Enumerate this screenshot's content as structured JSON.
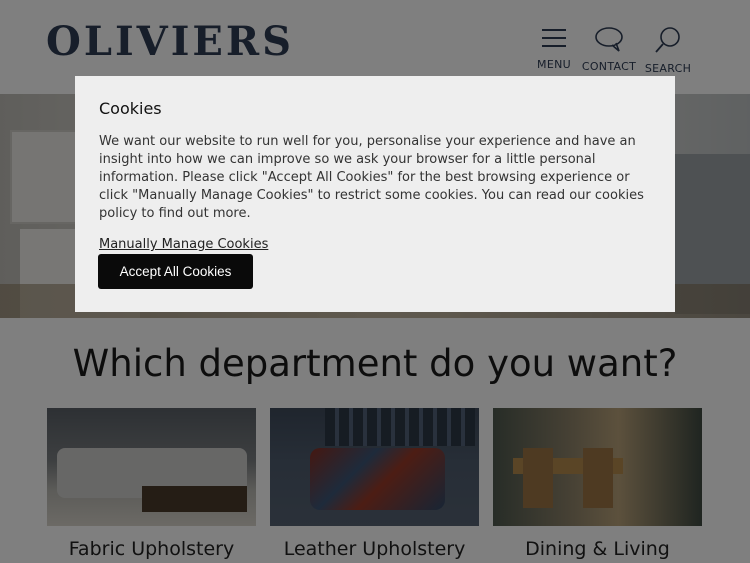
{
  "header": {
    "logo": "OLIVIERS",
    "nav": [
      {
        "label": "MENU",
        "icon": "hamburger-icon"
      },
      {
        "label": "CONTACT",
        "icon": "speech-bubble-icon"
      },
      {
        "label": "SEARCH",
        "icon": "magnifier-icon"
      }
    ],
    "brand_color": "#2f3d55"
  },
  "main": {
    "title": "Which department do you want?",
    "departments": [
      {
        "label": "Fabric Upholstery"
      },
      {
        "label": "Leather Upholstery"
      },
      {
        "label": "Dining & Living"
      }
    ]
  },
  "cookie_modal": {
    "title": "Cookies",
    "body": "We want our website to run well for you, personalise your experience and have an insight into how we can improve so we ask your browser for a little personal information. Please click \"Accept All Cookies\" for the best browsing experience or click \"Manually Manage Cookies\" to restrict some cookies. You can read our cookies policy to find out more.",
    "manage_link": "Manually Manage Cookies",
    "accept_button": "Accept All Cookies",
    "overlay_color": "rgba(0,0,0,0.5)",
    "button_color": "#0a0a0a"
  }
}
